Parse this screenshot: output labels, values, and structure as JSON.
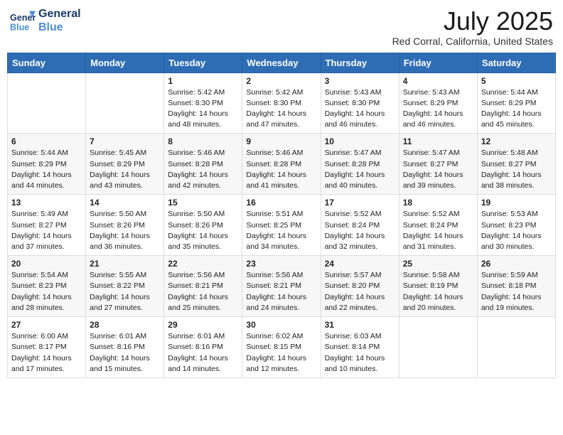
{
  "header": {
    "logo_line1": "General",
    "logo_line2": "Blue",
    "month_title": "July 2025",
    "location": "Red Corral, California, United States"
  },
  "days_of_week": [
    "Sunday",
    "Monday",
    "Tuesday",
    "Wednesday",
    "Thursday",
    "Friday",
    "Saturday"
  ],
  "weeks": [
    [
      {
        "day": "",
        "sunrise": "",
        "sunset": "",
        "daylight": ""
      },
      {
        "day": "",
        "sunrise": "",
        "sunset": "",
        "daylight": ""
      },
      {
        "day": "1",
        "sunrise": "Sunrise: 5:42 AM",
        "sunset": "Sunset: 8:30 PM",
        "daylight": "Daylight: 14 hours and 48 minutes."
      },
      {
        "day": "2",
        "sunrise": "Sunrise: 5:42 AM",
        "sunset": "Sunset: 8:30 PM",
        "daylight": "Daylight: 14 hours and 47 minutes."
      },
      {
        "day": "3",
        "sunrise": "Sunrise: 5:43 AM",
        "sunset": "Sunset: 8:30 PM",
        "daylight": "Daylight: 14 hours and 46 minutes."
      },
      {
        "day": "4",
        "sunrise": "Sunrise: 5:43 AM",
        "sunset": "Sunset: 8:29 PM",
        "daylight": "Daylight: 14 hours and 46 minutes."
      },
      {
        "day": "5",
        "sunrise": "Sunrise: 5:44 AM",
        "sunset": "Sunset: 8:29 PM",
        "daylight": "Daylight: 14 hours and 45 minutes."
      }
    ],
    [
      {
        "day": "6",
        "sunrise": "Sunrise: 5:44 AM",
        "sunset": "Sunset: 8:29 PM",
        "daylight": "Daylight: 14 hours and 44 minutes."
      },
      {
        "day": "7",
        "sunrise": "Sunrise: 5:45 AM",
        "sunset": "Sunset: 8:29 PM",
        "daylight": "Daylight: 14 hours and 43 minutes."
      },
      {
        "day": "8",
        "sunrise": "Sunrise: 5:46 AM",
        "sunset": "Sunset: 8:28 PM",
        "daylight": "Daylight: 14 hours and 42 minutes."
      },
      {
        "day": "9",
        "sunrise": "Sunrise: 5:46 AM",
        "sunset": "Sunset: 8:28 PM",
        "daylight": "Daylight: 14 hours and 41 minutes."
      },
      {
        "day": "10",
        "sunrise": "Sunrise: 5:47 AM",
        "sunset": "Sunset: 8:28 PM",
        "daylight": "Daylight: 14 hours and 40 minutes."
      },
      {
        "day": "11",
        "sunrise": "Sunrise: 5:47 AM",
        "sunset": "Sunset: 8:27 PM",
        "daylight": "Daylight: 14 hours and 39 minutes."
      },
      {
        "day": "12",
        "sunrise": "Sunrise: 5:48 AM",
        "sunset": "Sunset: 8:27 PM",
        "daylight": "Daylight: 14 hours and 38 minutes."
      }
    ],
    [
      {
        "day": "13",
        "sunrise": "Sunrise: 5:49 AM",
        "sunset": "Sunset: 8:27 PM",
        "daylight": "Daylight: 14 hours and 37 minutes."
      },
      {
        "day": "14",
        "sunrise": "Sunrise: 5:50 AM",
        "sunset": "Sunset: 8:26 PM",
        "daylight": "Daylight: 14 hours and 36 minutes."
      },
      {
        "day": "15",
        "sunrise": "Sunrise: 5:50 AM",
        "sunset": "Sunset: 8:26 PM",
        "daylight": "Daylight: 14 hours and 35 minutes."
      },
      {
        "day": "16",
        "sunrise": "Sunrise: 5:51 AM",
        "sunset": "Sunset: 8:25 PM",
        "daylight": "Daylight: 14 hours and 34 minutes."
      },
      {
        "day": "17",
        "sunrise": "Sunrise: 5:52 AM",
        "sunset": "Sunset: 8:24 PM",
        "daylight": "Daylight: 14 hours and 32 minutes."
      },
      {
        "day": "18",
        "sunrise": "Sunrise: 5:52 AM",
        "sunset": "Sunset: 8:24 PM",
        "daylight": "Daylight: 14 hours and 31 minutes."
      },
      {
        "day": "19",
        "sunrise": "Sunrise: 5:53 AM",
        "sunset": "Sunset: 8:23 PM",
        "daylight": "Daylight: 14 hours and 30 minutes."
      }
    ],
    [
      {
        "day": "20",
        "sunrise": "Sunrise: 5:54 AM",
        "sunset": "Sunset: 8:23 PM",
        "daylight": "Daylight: 14 hours and 28 minutes."
      },
      {
        "day": "21",
        "sunrise": "Sunrise: 5:55 AM",
        "sunset": "Sunset: 8:22 PM",
        "daylight": "Daylight: 14 hours and 27 minutes."
      },
      {
        "day": "22",
        "sunrise": "Sunrise: 5:56 AM",
        "sunset": "Sunset: 8:21 PM",
        "daylight": "Daylight: 14 hours and 25 minutes."
      },
      {
        "day": "23",
        "sunrise": "Sunrise: 5:56 AM",
        "sunset": "Sunset: 8:21 PM",
        "daylight": "Daylight: 14 hours and 24 minutes."
      },
      {
        "day": "24",
        "sunrise": "Sunrise: 5:57 AM",
        "sunset": "Sunset: 8:20 PM",
        "daylight": "Daylight: 14 hours and 22 minutes."
      },
      {
        "day": "25",
        "sunrise": "Sunrise: 5:58 AM",
        "sunset": "Sunset: 8:19 PM",
        "daylight": "Daylight: 14 hours and 20 minutes."
      },
      {
        "day": "26",
        "sunrise": "Sunrise: 5:59 AM",
        "sunset": "Sunset: 8:18 PM",
        "daylight": "Daylight: 14 hours and 19 minutes."
      }
    ],
    [
      {
        "day": "27",
        "sunrise": "Sunrise: 6:00 AM",
        "sunset": "Sunset: 8:17 PM",
        "daylight": "Daylight: 14 hours and 17 minutes."
      },
      {
        "day": "28",
        "sunrise": "Sunrise: 6:01 AM",
        "sunset": "Sunset: 8:16 PM",
        "daylight": "Daylight: 14 hours and 15 minutes."
      },
      {
        "day": "29",
        "sunrise": "Sunrise: 6:01 AM",
        "sunset": "Sunset: 8:16 PM",
        "daylight": "Daylight: 14 hours and 14 minutes."
      },
      {
        "day": "30",
        "sunrise": "Sunrise: 6:02 AM",
        "sunset": "Sunset: 8:15 PM",
        "daylight": "Daylight: 14 hours and 12 minutes."
      },
      {
        "day": "31",
        "sunrise": "Sunrise: 6:03 AM",
        "sunset": "Sunset: 8:14 PM",
        "daylight": "Daylight: 14 hours and 10 minutes."
      },
      {
        "day": "",
        "sunrise": "",
        "sunset": "",
        "daylight": ""
      },
      {
        "day": "",
        "sunrise": "",
        "sunset": "",
        "daylight": ""
      }
    ]
  ]
}
